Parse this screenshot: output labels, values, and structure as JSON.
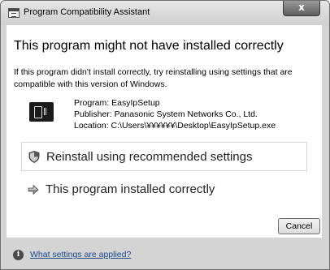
{
  "window": {
    "title": "Program Compatibility Assistant",
    "close_label": "x"
  },
  "main": {
    "heading": "This program might not have installed correctly",
    "description": "If this program didn't install correctly, try reinstalling using settings that are compatible with this version of Windows.",
    "program": {
      "name": "Program: EasyIpSetup",
      "publisher": "Publisher: Panasonic System Networks Co., Ltd.",
      "location": "Location: C:\\Users\\¥¥¥¥¥¥\\Desktop\\EasyIpSetup.exe",
      "icon": "program-icon"
    },
    "options": {
      "reinstall": {
        "label": "Reinstall using recommended settings",
        "icon": "shield-icon"
      },
      "installed": {
        "label": "This program installed correctly",
        "icon": "arrow-icon"
      }
    }
  },
  "footer": {
    "cancel_label": "Cancel",
    "help_link": "What settings are applied?",
    "info_icon": "info-icon"
  }
}
